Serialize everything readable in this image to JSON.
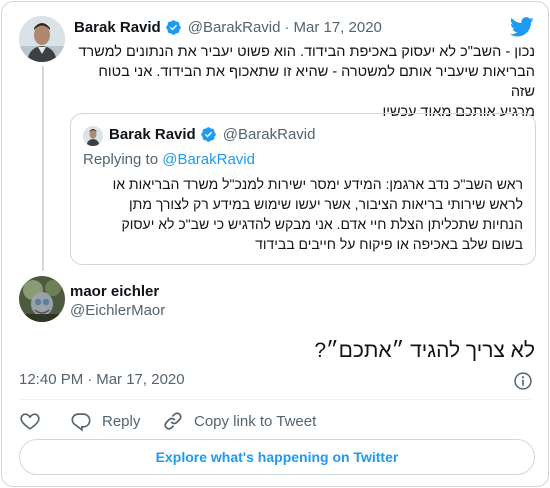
{
  "parent_tweet": {
    "display_name": "Barak Ravid",
    "handle": "@BarakRavid",
    "separator": "·",
    "date": "Mar 17, 2020",
    "lines": [
      "נכון - השב\"כ לא יעסוק באכיפת הבידוד. הוא פשוט יעביר את הנתונים למשרד",
      "הבריאות שיעביר אותם למשטרה - שהיא זו שתאכוף את הבידוד. אני בטוח שזה",
      "מרגיע אותכם מאוד עכשיו"
    ],
    "quoted": {
      "display_name": "Barak Ravid",
      "handle": "@BarakRavid",
      "replying_prefix": "Replying to",
      "replying_to": "@BarakRavid",
      "lines": [
        "ראש השב\"כ נדב ארגמן: המידע ימסר ישירות למנכ\"ל משרד הבריאות או",
        "לראש שירותי בריאות הציבור, אשר יעשו שימוש במידע רק לצורך מתן",
        "הנחיות שתכליתן הצלת חיי אדם. אני מבקש להדגיש כי  שב\"כ לא יעסוק",
        "בשום שלב באכיפה או פיקוח על חייבים בבידוד"
      ]
    }
  },
  "main_tweet": {
    "display_name": "maor eichler",
    "handle": "@EichlerMaor",
    "text": "לא צריך להגיד ״אתכם״?",
    "time": "12:40 PM",
    "separator": "·",
    "date": "Mar 17, 2020"
  },
  "actions": {
    "like_label": "",
    "reply_label": "Reply",
    "copy_label": "Copy link to Tweet"
  },
  "explore_label": "Explore what's happening on Twitter",
  "icons": {
    "brand": "twitter-bird-icon",
    "verified": "verified-badge-icon",
    "info": "info-icon",
    "like": "heart-icon",
    "reply": "reply-icon",
    "copy": "link-icon"
  },
  "colors": {
    "twitter_blue": "#1d9bf0",
    "text_primary": "#0f1419",
    "text_secondary": "#536471",
    "border": "#cfd9de"
  }
}
